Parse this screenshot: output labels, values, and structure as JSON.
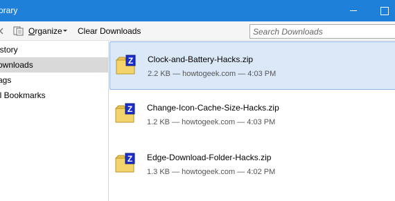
{
  "window": {
    "title": "orary"
  },
  "toolbar": {
    "organize_label_underlined": "O",
    "organize_label_rest": "rganize",
    "clear_downloads_label": "Clear Downloads",
    "search_placeholder": "Search Downloads"
  },
  "sidebar": {
    "items": [
      {
        "label": "istory",
        "selected": false
      },
      {
        "label": "ownloads",
        "selected": true
      },
      {
        "label": "ags",
        "selected": false
      },
      {
        "label": "ll Bookmarks",
        "selected": false
      }
    ]
  },
  "downloads": [
    {
      "name": "Clock-and-Battery-Hacks.zip",
      "meta": "2.2 KB — howtogeek.com — 4:03 PM",
      "selected": true,
      "icon": "zip-folder-icon"
    },
    {
      "name": "Change-Icon-Cache-Size-Hacks.zip",
      "meta": "1.2 KB — howtogeek.com — 4:03 PM",
      "selected": false,
      "icon": "zip-folder-icon"
    },
    {
      "name": "Edge-Download-Folder-Hacks.zip",
      "meta": "1.3 KB — howtogeek.com — 4:02 PM",
      "selected": false,
      "icon": "zip-folder-icon"
    }
  ],
  "colors": {
    "titlebar": "#1e80d8",
    "selection": "#dbe8f7",
    "sidebar_selection": "#d9d9d9"
  }
}
